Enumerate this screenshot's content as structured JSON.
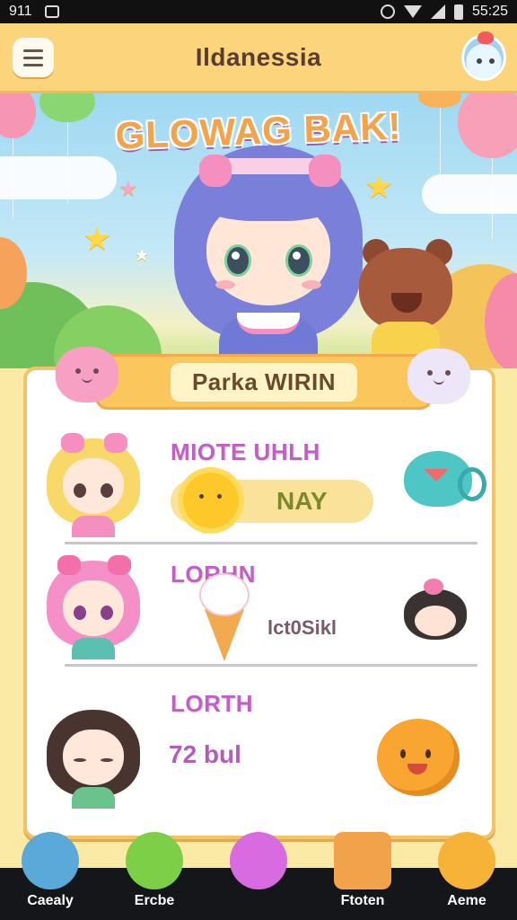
{
  "status_bar": {
    "left_text": "911",
    "time": "55:25"
  },
  "header": {
    "title": "Ildanessia",
    "menu_icon": "hamburger-menu-icon",
    "profile_icon": "mascot-icon"
  },
  "hero": {
    "title": "GLOWAG BAK!"
  },
  "panel": {
    "title": "Parka WIRIN",
    "rows": [
      {
        "name": "MIOTE UHLH",
        "value": "NAY",
        "left_icon": "sun-icon",
        "right_icon": "teapot-icon"
      },
      {
        "name": "LORHN",
        "value": "lct0Sikl",
        "left_icon": "ice-cream-icon",
        "right_icon": "cat-icon"
      },
      {
        "name": "LORTH",
        "value": "72 bul",
        "right_icon": "orange-blob-icon"
      }
    ]
  },
  "nav": {
    "items": [
      {
        "label": "Caealy",
        "icon": "house-icon"
      },
      {
        "label": "Ercbe",
        "icon": "apple-icon"
      },
      {
        "label": "",
        "icon": "bubble-icon"
      },
      {
        "label": "Ftoten",
        "icon": "book-icon"
      },
      {
        "label": "Aeme",
        "icon": "mascot-icon"
      }
    ]
  },
  "colors": {
    "header_bg": "#fbd47b",
    "panel_header": "#fbc65c",
    "name_text": "#c15fc3",
    "nav_bg": "#15161a"
  }
}
